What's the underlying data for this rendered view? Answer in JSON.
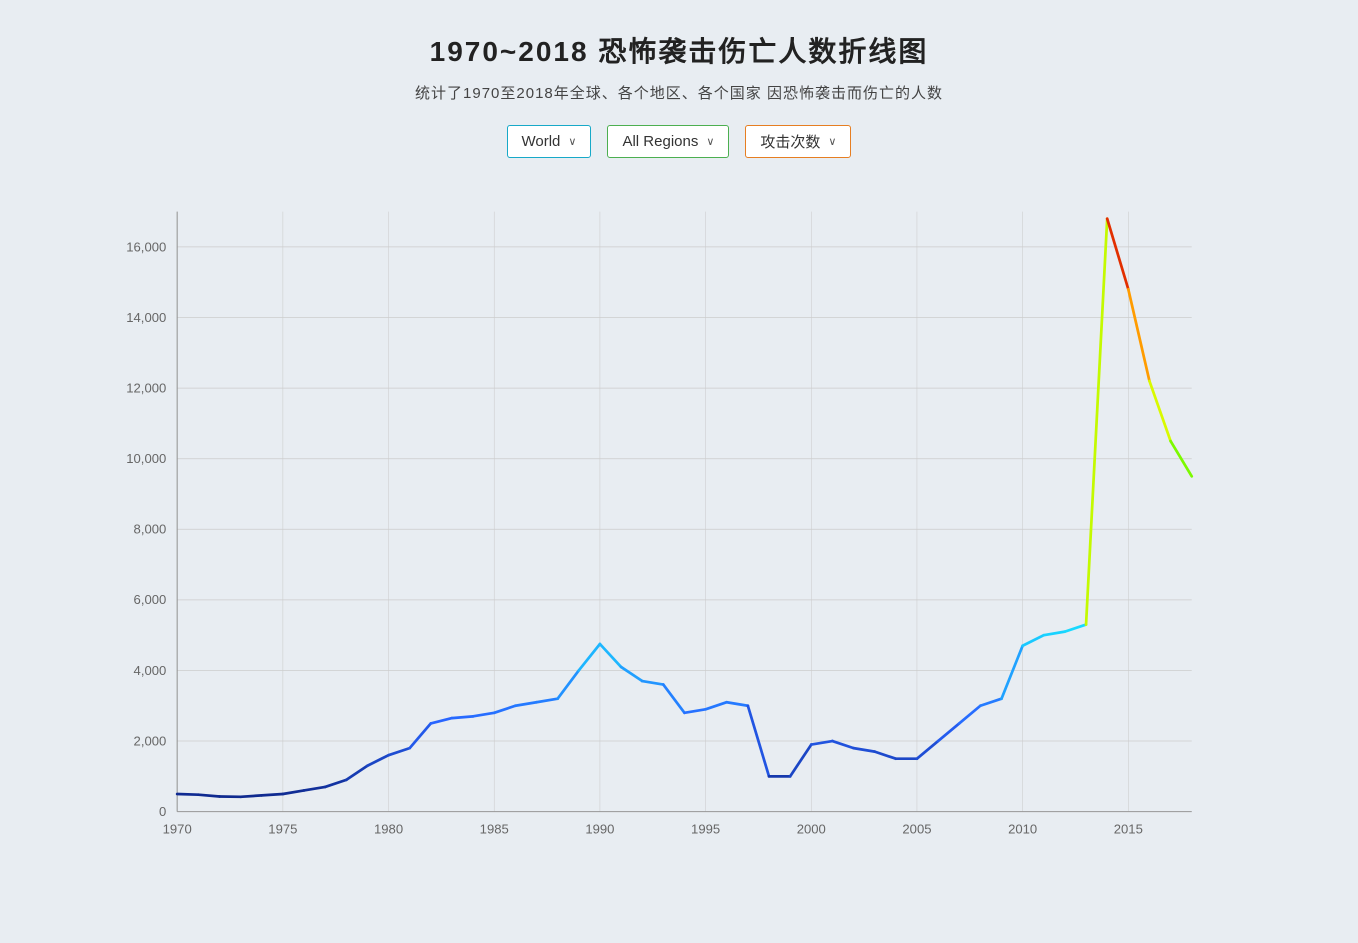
{
  "title": "1970~2018 恐怖袭击伤亡人数折线图",
  "subtitle": "统计了1970至2018年全球、各个地区、各个国家 因恐怖袭击而伤亡的人数",
  "controls": {
    "world": {
      "label": "World",
      "border": "blue"
    },
    "region": {
      "label": "All Regions",
      "border": "green"
    },
    "metric": {
      "label": "攻击次数",
      "border": "orange"
    }
  },
  "chart": {
    "yAxis": {
      "labels": [
        "0",
        "2,000",
        "4,000",
        "6,000",
        "8,000",
        "10,000",
        "12,000",
        "14,000",
        "16,000"
      ],
      "max": 17000
    },
    "xAxis": {
      "labels": [
        "1970",
        "1975",
        "1980",
        "1985",
        "1990",
        "1995",
        "2000",
        "2005",
        "2010",
        "2015"
      ]
    },
    "dataPoints": [
      {
        "year": 1970,
        "value": 500
      },
      {
        "year": 1971,
        "value": 480
      },
      {
        "year": 1972,
        "value": 430
      },
      {
        "year": 1973,
        "value": 420
      },
      {
        "year": 1974,
        "value": 460
      },
      {
        "year": 1975,
        "value": 500
      },
      {
        "year": 1976,
        "value": 600
      },
      {
        "year": 1977,
        "value": 700
      },
      {
        "year": 1978,
        "value": 900
      },
      {
        "year": 1979,
        "value": 1300
      },
      {
        "year": 1980,
        "value": 1600
      },
      {
        "year": 1981,
        "value": 1800
      },
      {
        "year": 1982,
        "value": 2500
      },
      {
        "year": 1983,
        "value": 2650
      },
      {
        "year": 1984,
        "value": 2700
      },
      {
        "year": 1985,
        "value": 2800
      },
      {
        "year": 1986,
        "value": 3000
      },
      {
        "year": 1987,
        "value": 3100
      },
      {
        "year": 1988,
        "value": 3200
      },
      {
        "year": 1989,
        "value": 4000
      },
      {
        "year": 1990,
        "value": 4750
      },
      {
        "year": 1991,
        "value": 4100
      },
      {
        "year": 1992,
        "value": 3700
      },
      {
        "year": 1993,
        "value": 3600
      },
      {
        "year": 1994,
        "value": 2800
      },
      {
        "year": 1995,
        "value": 2900
      },
      {
        "year": 1996,
        "value": 3100
      },
      {
        "year": 1997,
        "value": 3000
      },
      {
        "year": 1998,
        "value": 1000
      },
      {
        "year": 1999,
        "value": 1000
      },
      {
        "year": 2000,
        "value": 1900
      },
      {
        "year": 2001,
        "value": 2000
      },
      {
        "year": 2002,
        "value": 1800
      },
      {
        "year": 2003,
        "value": 1700
      },
      {
        "year": 2004,
        "value": 1500
      },
      {
        "year": 2005,
        "value": 1500
      },
      {
        "year": 2006,
        "value": 2000
      },
      {
        "year": 2007,
        "value": 2500
      },
      {
        "year": 2008,
        "value": 3000
      },
      {
        "year": 2009,
        "value": 3200
      },
      {
        "year": 2010,
        "value": 4700
      },
      {
        "year": 2011,
        "value": 5000
      },
      {
        "year": 2012,
        "value": 5100
      },
      {
        "year": 2013,
        "value": 5300
      },
      {
        "year": 2014,
        "value": 16800
      },
      {
        "year": 2015,
        "value": 14800
      },
      {
        "year": 2016,
        "value": 12200
      },
      {
        "year": 2017,
        "value": 10500
      },
      {
        "year": 2018,
        "value": 9500
      }
    ]
  }
}
